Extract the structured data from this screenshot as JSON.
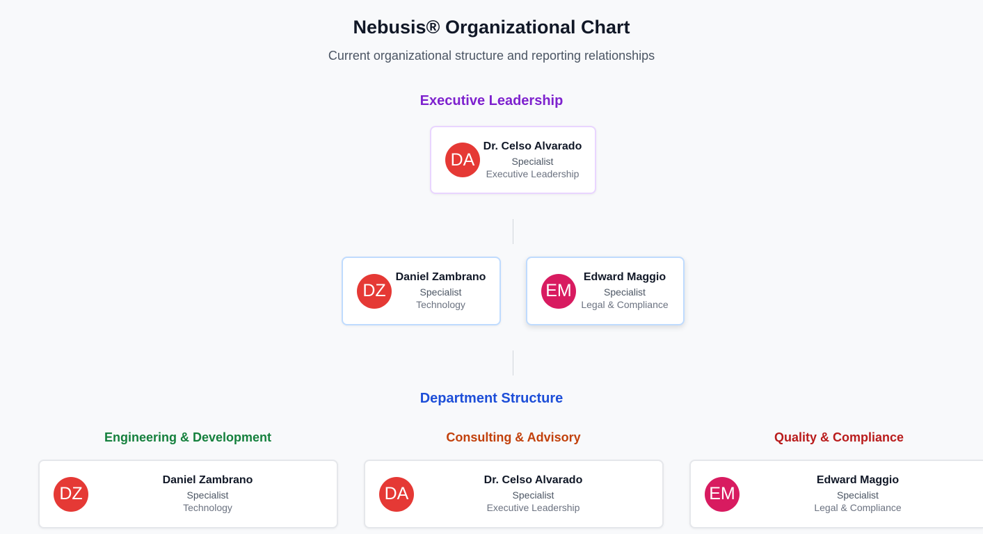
{
  "header": {
    "title": "Nebusis® Organizational Chart",
    "subtitle": "Current organizational structure and reporting relationships"
  },
  "executive": {
    "heading": "Executive Leadership",
    "leader": {
      "initials": "DA",
      "name": "Dr. Celso Alvarado",
      "role": "Specialist",
      "department": "Executive Leadership",
      "avatar_color": "#e53935"
    },
    "reports": [
      {
        "initials": "DZ",
        "name": "Daniel Zambrano",
        "role": "Specialist",
        "department": "Technology",
        "avatar_color": "#e53935"
      },
      {
        "initials": "EM",
        "name": "Edward Maggio",
        "role": "Specialist",
        "department": "Legal & Compliance",
        "avatar_color": "#d81b60"
      }
    ]
  },
  "departments": {
    "heading": "Department Structure",
    "groups": [
      {
        "title": "Engineering & Development",
        "title_color": "#15803d",
        "member": {
          "initials": "DZ",
          "name": "Daniel Zambrano",
          "role": "Specialist",
          "department": "Technology",
          "avatar_color": "#e53935"
        }
      },
      {
        "title": "Consulting & Advisory",
        "title_color": "#c2410c",
        "member": {
          "initials": "DA",
          "name": "Dr. Celso Alvarado",
          "role": "Specialist",
          "department": "Executive Leadership",
          "avatar_color": "#e53935"
        }
      },
      {
        "title": "Quality & Compliance",
        "title_color": "#b91c1c",
        "member": {
          "initials": "EM",
          "name": "Edward Maggio",
          "role": "Specialist",
          "department": "Legal & Compliance",
          "avatar_color": "#d81b60"
        }
      }
    ]
  },
  "colors": {
    "exec_heading": "#7e22ce",
    "dept_heading": "#1d4ed8"
  }
}
